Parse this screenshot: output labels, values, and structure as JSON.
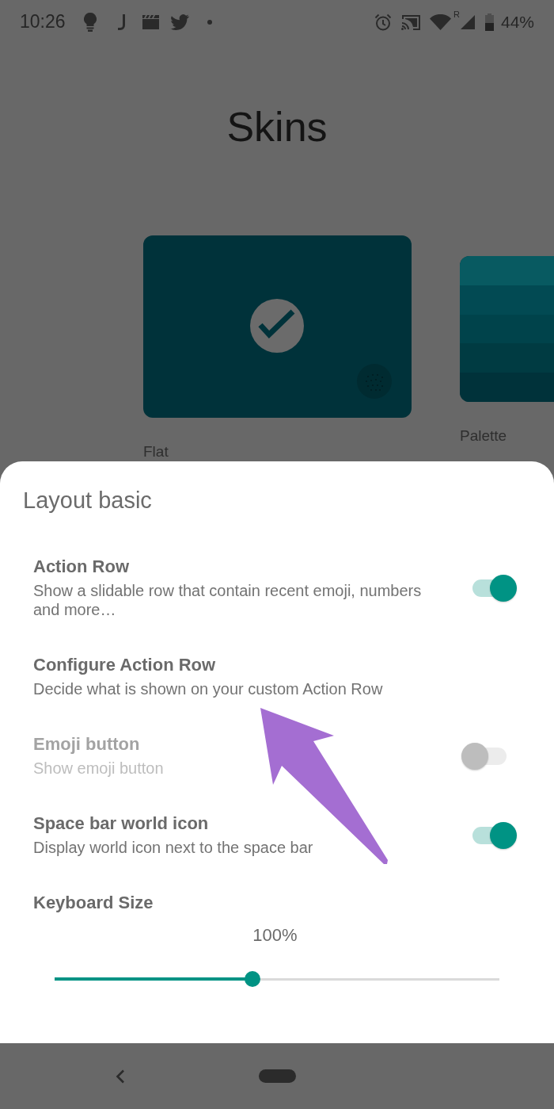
{
  "status_bar": {
    "time": "10:26",
    "roaming": "R",
    "battery": "44%"
  },
  "title": "Skins",
  "skins": [
    {
      "label": "Flat",
      "kind": "flat",
      "selected": true
    },
    {
      "label": "Palette",
      "kind": "palette",
      "selected": false
    }
  ],
  "sheet": {
    "title": "Layout basic",
    "settings": [
      {
        "kind": "switch",
        "title": "Action Row",
        "summary": "Show a slidable row that contain recent emoji, numbers and more…",
        "on": true,
        "disabled": false
      },
      {
        "kind": "link",
        "title": "Configure Action Row",
        "summary": "Decide what is shown on your custom Action Row",
        "disabled": false
      },
      {
        "kind": "switch",
        "title": "Emoji button",
        "summary": "Show emoji button",
        "on": false,
        "disabled": true
      },
      {
        "kind": "switch",
        "title": "Space bar world icon",
        "summary": "Display world icon next to the space bar",
        "on": true,
        "disabled": false
      },
      {
        "kind": "slider",
        "title": "Keyboard Size",
        "reading": "100%",
        "level": 0.445,
        "disabled": false
      }
    ]
  }
}
